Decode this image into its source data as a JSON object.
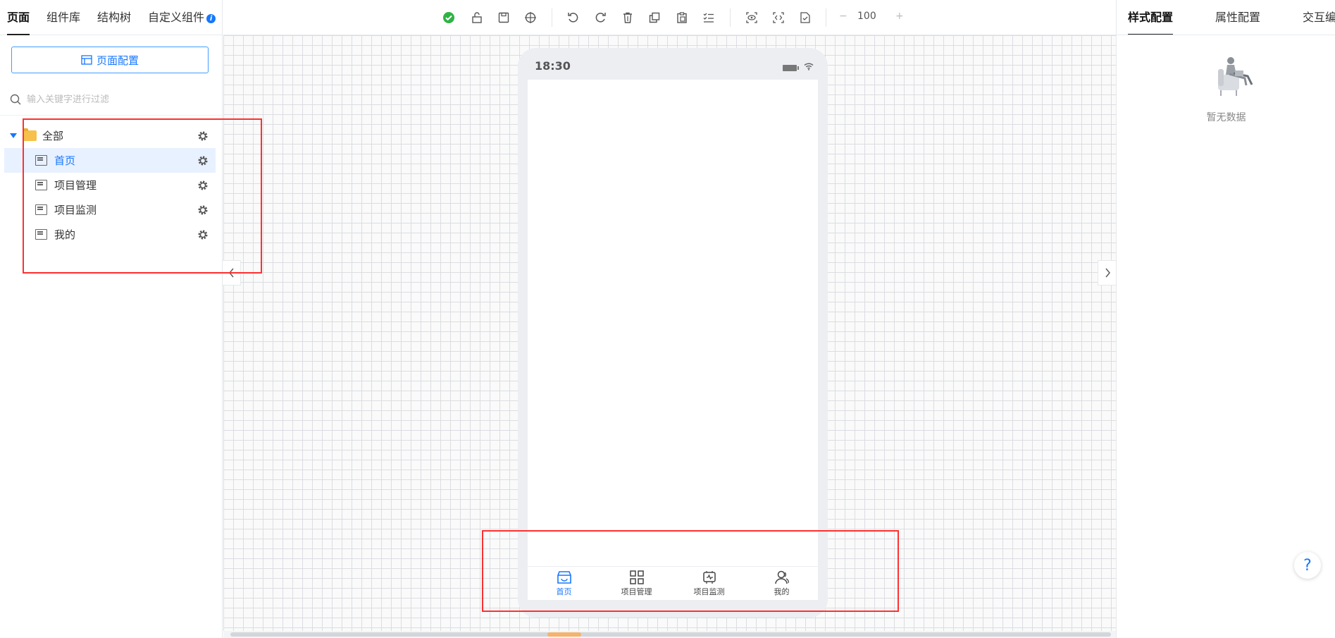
{
  "left_panel": {
    "tabs": [
      {
        "label": "页面",
        "active": true
      },
      {
        "label": "组件库"
      },
      {
        "label": "结构树"
      },
      {
        "label": "自定义组件"
      }
    ],
    "info_badge": "i",
    "page_config_button": "页面配置",
    "search_placeholder": "输入关键字进行过滤",
    "tree": {
      "root": "全部",
      "children": [
        "首页",
        "项目管理",
        "项目监测",
        "我的"
      ],
      "selected": "首页"
    }
  },
  "toolbar": {
    "zoom_value": "100",
    "zoom_minus": "−",
    "zoom_plus": "+"
  },
  "phone": {
    "status_time": "18:30",
    "tabbar": [
      {
        "label": "首页",
        "icon": "home-icon",
        "active": true
      },
      {
        "label": "项目管理",
        "icon": "grid-icon"
      },
      {
        "label": "项目监测",
        "icon": "monitor-icon"
      },
      {
        "label": "我的",
        "icon": "user-icon"
      }
    ]
  },
  "right_panel": {
    "tabs": [
      {
        "label": "样式配置",
        "active": true
      },
      {
        "label": "属性配置"
      },
      {
        "label": "交互编排"
      }
    ],
    "empty_text": "暂无数据",
    "help": "?"
  },
  "colors": {
    "accent": "#1677ff",
    "annotation": "#ff3030",
    "selected_bg": "#e8f1ff"
  }
}
